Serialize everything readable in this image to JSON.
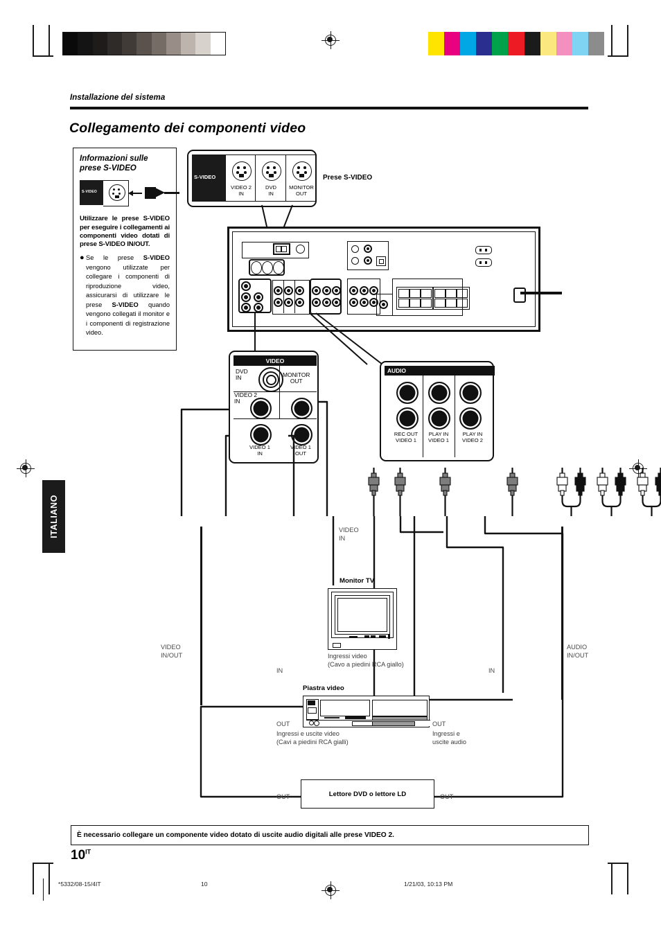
{
  "page": {
    "section_label": "Installazione del sistema",
    "title": "Collegamento dei componenti video",
    "number": "10",
    "number_sup": "IT",
    "side_tab": "ITALIANO",
    "note": "È necessario collegare un componente video dotato di uscite audio digitali alle prese VIDEO 2."
  },
  "footer": {
    "left": "*5332/08-15/4IT",
    "center": "10",
    "right": "1/21/03, 10:13 PM"
  },
  "info_box": {
    "title": "Informazioni sulle prese S-VIDEO",
    "illustration_label": "S-VIDEO",
    "strong_text": "Utilizzare le prese S-VIDEO per eseguire i collegamenti ai componenti video dotati di prese S-VIDEO IN/OUT.",
    "bullet_pre": "Se le prese ",
    "bullet_b1": "S-VIDEO",
    "bullet_mid": " vengono utilizzate per collegare i componenti di riproduzione video, assicurarsi di utilizzare le prese ",
    "bullet_b2": "S-VIDEO",
    "bullet_post": " quando vengono collegati il monitor e i componenti di registrazione video."
  },
  "svideo_panel": {
    "bar_label": "S-VIDEO",
    "callout": "Prese S-VIDEO",
    "jacks": [
      {
        "line1": "VIDEO 2",
        "line2": "IN"
      },
      {
        "line1": "DVD",
        "line2": "IN"
      },
      {
        "line1": "MONITOR",
        "line2": "OUT"
      }
    ]
  },
  "video_panel": {
    "bar_label": "VIDEO",
    "dvd_in": "DVD\nIN",
    "labels": {
      "dvd_in_l1": "DVD",
      "dvd_in_l2": "IN",
      "monitor_out_l1": "MONITOR",
      "monitor_out_l2": "OUT",
      "video2_in_l1": "VIDEO 2",
      "video2_in_l2": "IN",
      "video1_in_l1": "VIDEO 1",
      "video1_in_l2": "IN",
      "video1_out_l1": "VIDEO 1",
      "video1_out_l2": "OUT"
    }
  },
  "audio_panel": {
    "bar_label": "AUDIO",
    "labels": {
      "rec_out_l1": "REC OUT",
      "rec_out_l2": "VIDEO 1",
      "play_in1_l1": "PLAY IN",
      "play_in1_l2": "VIDEO 1",
      "play_in2_l1": "PLAY IN",
      "play_in2_l2": "VIDEO 2"
    }
  },
  "diagram": {
    "video_in_l1": "VIDEO",
    "video_in_l2": "IN",
    "video_inout_l1": "VIDEO",
    "video_inout_l2": "IN/OUT",
    "audio_inout_l1": "AUDIO",
    "audio_inout_l2": "IN/OUT",
    "monitor_tv_title": "Monitor TV",
    "monitor_tv_cap_l1": "Ingressi video",
    "monitor_tv_cap_l2": "(Cavo a piedini RCA giallo)",
    "vcr_title": "Piastra video",
    "vcr_cap_l1": "Ingressi e uscite video",
    "vcr_cap_l2": "(Cavi a piedini RCA gialli)",
    "vcr_audio_cap_l1": "Ingressi e",
    "vcr_audio_cap_l2": "uscite audio",
    "dvd_title": "Lettore DVD o lettore LD",
    "in_left": "IN",
    "in_right": "IN",
    "out_tv_left": "OUT",
    "out_tv_right": "OUT",
    "out_dvd_left": "OUT",
    "out_dvd_right": "OUT"
  },
  "colors": {
    "ink": "#111111",
    "gray_bars": [
      "#0a0a0a",
      "#141414",
      "#1e1c1b",
      "#2f2b29",
      "#413b38",
      "#5a524d",
      "#756c66",
      "#988e87",
      "#bdb4ae",
      "#d8d2cd",
      "#ffffff"
    ],
    "color_bars": [
      "#ffe400",
      "#e8027f",
      "#00a7e4",
      "#2a2f8f",
      "#00a14b",
      "#ed1c24",
      "#1b1b1b",
      "#fbe87f",
      "#f490c0",
      "#7fd4f4",
      "#8c8c8c"
    ]
  }
}
